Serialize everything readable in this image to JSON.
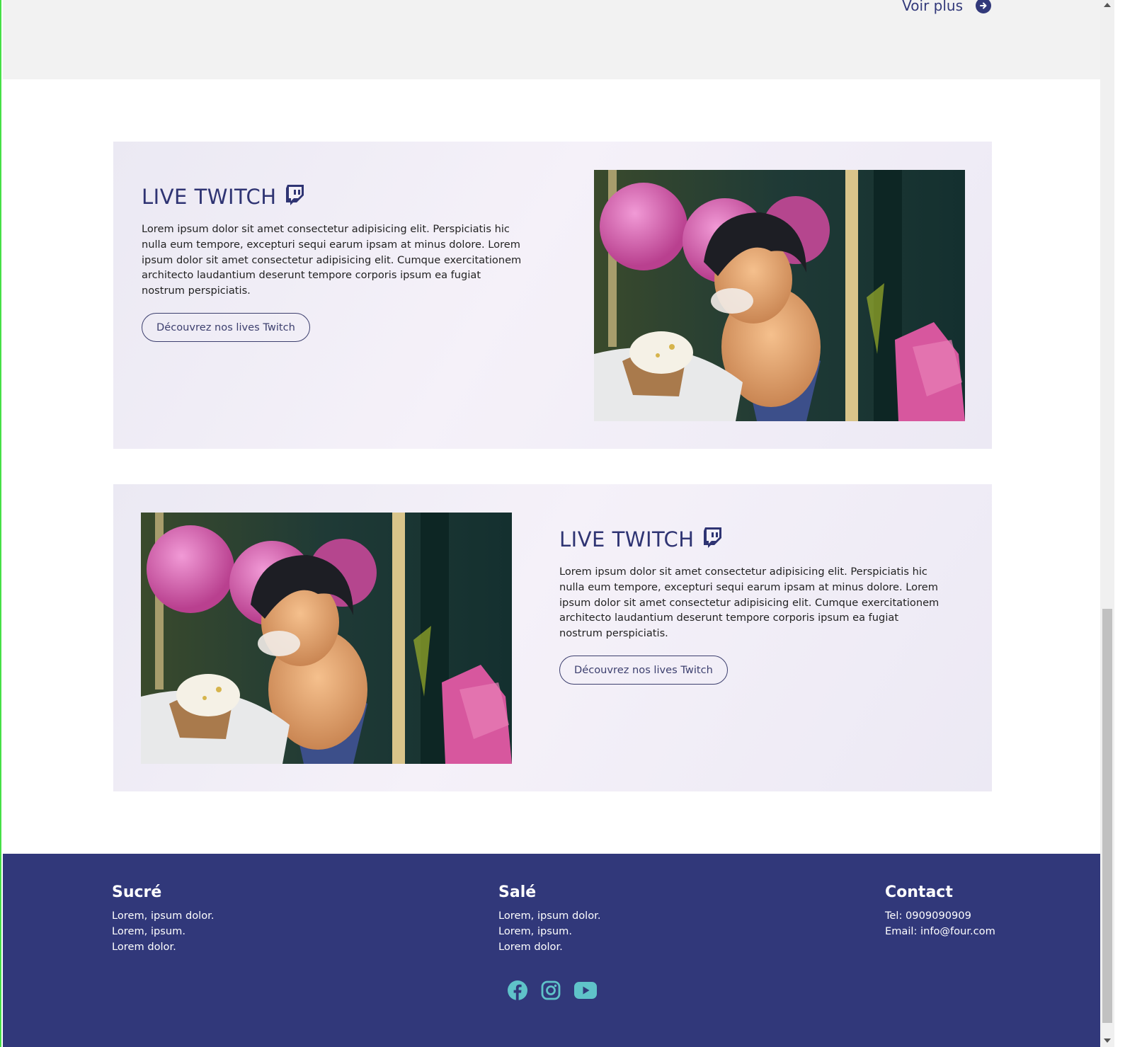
{
  "top": {
    "voir_plus": "Voir plus"
  },
  "cards": [
    {
      "title": "LIVE TWITCH",
      "body": "Lorem ipsum dolor sit amet consectetur adipisicing elit. Perspiciatis hic nulla eum tempore, excepturi sequi earum ipsam at minus dolore. Lorem ipsum dolor sit amet consectetur adipisicing elit. Cumque exercitationem architecto laudantium deserunt tempore corporis ipsum ea fugiat nostrum perspiciatis.",
      "button": "Découvrez nos lives Twitch"
    },
    {
      "title": "LIVE TWITCH",
      "body": "Lorem ipsum dolor sit amet consectetur adipisicing elit. Perspiciatis hic nulla eum tempore, excepturi sequi earum ipsam at minus dolore. Lorem ipsum dolor sit amet consectetur adipisicing elit. Cumque exercitationem architecto laudantium deserunt tempore corporis ipsum ea fugiat nostrum perspiciatis.",
      "button": "Découvrez nos lives Twitch"
    }
  ],
  "footer": {
    "sucre": {
      "title": "Sucré",
      "lines": [
        "Lorem, ipsum dolor.",
        "Lorem, ipsum.",
        "Lorem dolor."
      ]
    },
    "sale": {
      "title": "Salé",
      "lines": [
        "Lorem, ipsum dolor.",
        "Lorem, ipsum.",
        "Lorem dolor."
      ]
    },
    "contact": {
      "title": "Contact",
      "tel": "Tel: 0909090909",
      "email": "Email: info@four.com"
    },
    "socials": [
      "facebook-icon",
      "instagram-icon",
      "youtube-icon"
    ]
  },
  "colors": {
    "brand_navy": "#31387a",
    "accent_teal": "#5fc3c9",
    "card_bg": "#efecf6"
  }
}
